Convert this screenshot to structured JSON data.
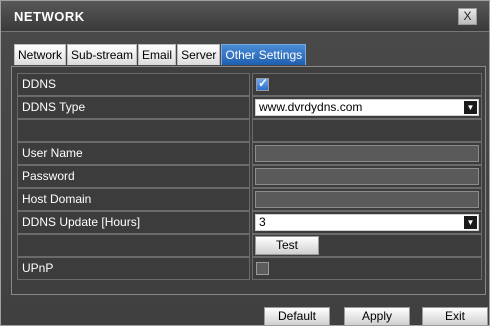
{
  "window": {
    "title": "NETWORK",
    "close_label": "X"
  },
  "tabs": [
    "Network",
    "Sub-stream",
    "Email",
    "Server",
    "Other Settings"
  ],
  "active_tab": "Other Settings",
  "rows": {
    "ddns": {
      "label": "DDNS",
      "checked": true,
      "check_glyph": "✓"
    },
    "ddns_type": {
      "label": "DDNS Type",
      "value": "www.dvrdydns.com",
      "arrow": "▼"
    },
    "user_name": {
      "label": "User Name",
      "value": ""
    },
    "password": {
      "label": "Password",
      "value": ""
    },
    "host_domain": {
      "label": "Host Domain",
      "value": ""
    },
    "ddns_update": {
      "label": "DDNS Update [Hours]",
      "value": "3",
      "arrow": "▼"
    },
    "test": {
      "label": "Test"
    },
    "upnp": {
      "label": "UPnP",
      "checked": false
    }
  },
  "buttons": {
    "default": "Default",
    "apply": "Apply",
    "exit": "Exit"
  },
  "colors": {
    "accent": "#2c6fd0",
    "active_tab": "#1f5fb0",
    "background": "#3f3f3f"
  },
  "icons": {
    "close": "close-icon",
    "check": "checkmark-icon",
    "dropdown": "chevron-down-icon"
  }
}
